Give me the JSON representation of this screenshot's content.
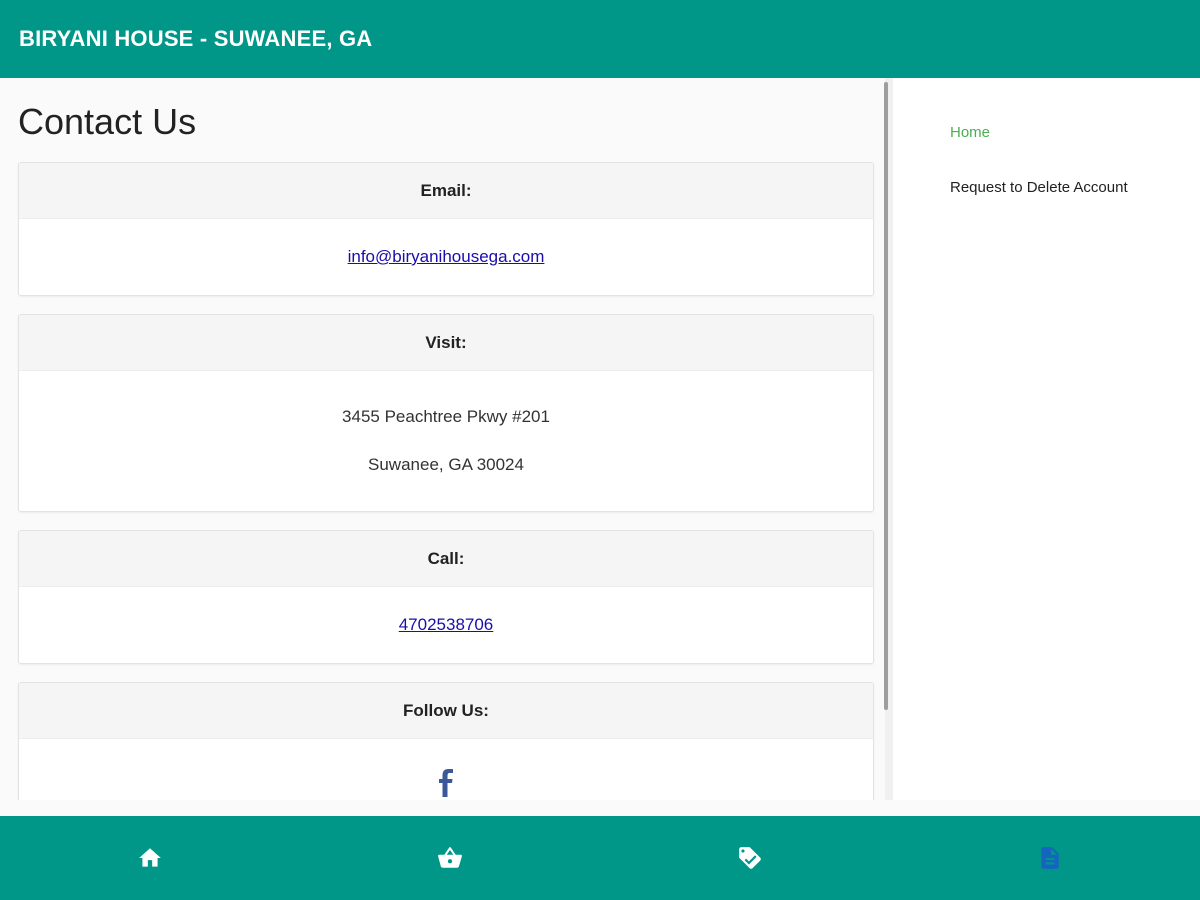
{
  "header": {
    "title": "BIRYANI HOUSE - SUWANEE, GA"
  },
  "page": {
    "title": "Contact Us"
  },
  "email": {
    "label": "Email:",
    "value": "info@biryanihousega.com"
  },
  "visit": {
    "label": "Visit:",
    "line1": "3455 Peachtree Pkwy #201",
    "line2": "Suwanee, GA 30024"
  },
  "call": {
    "label": "Call:",
    "value": "4702538706"
  },
  "follow": {
    "label": "Follow Us:",
    "icon": "facebook-icon"
  },
  "sidebar": {
    "items": [
      {
        "label": "Home",
        "active": true
      },
      {
        "label": "Request to Delete Account",
        "active": false
      }
    ]
  },
  "bottom_nav": {
    "items": [
      {
        "icon": "home-icon"
      },
      {
        "icon": "basket-icon"
      },
      {
        "icon": "tag-icon"
      },
      {
        "icon": "document-icon",
        "active": true
      }
    ]
  },
  "colors": {
    "brand": "#009688",
    "active_link": "#4caf50",
    "active_nav": "#1565c0",
    "facebook": "#3b5998"
  }
}
